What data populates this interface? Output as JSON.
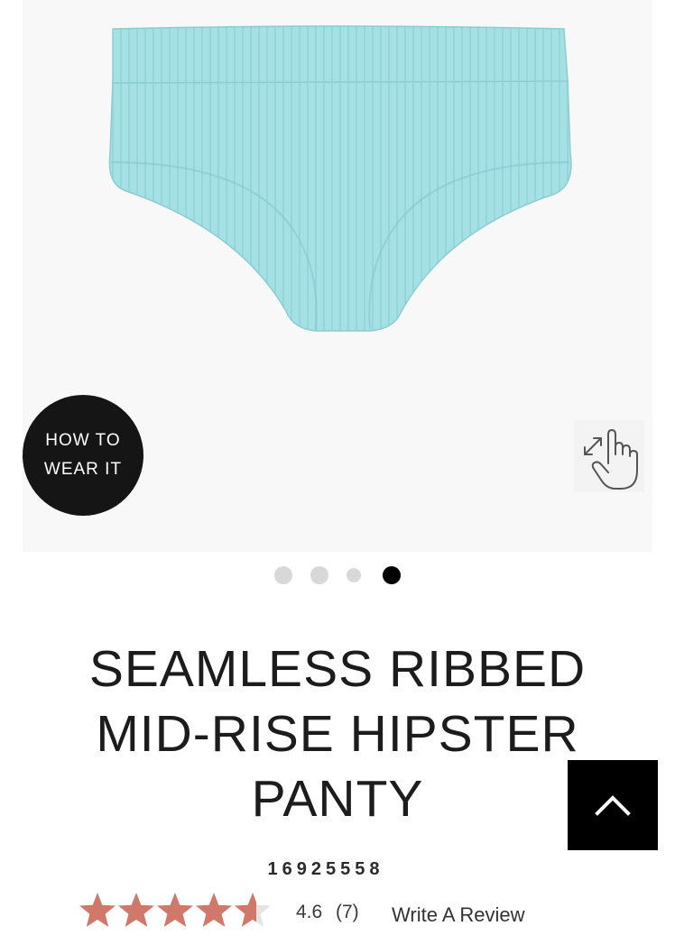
{
  "gallery": {
    "how_to_wear_line1": "HOW TO",
    "how_to_wear_line2": "WEAR IT",
    "zoom_icon": "pinch-zoom-hand-icon",
    "product_color": "#a4e0e4",
    "total_slides": 4,
    "active_slide": 4
  },
  "product": {
    "title_line1": "SEAMLESS RIBBED",
    "title_line2": "MID-RISE HIPSTER",
    "title_line3": "PANTY",
    "sku": "16925558"
  },
  "rating": {
    "value": "4.6",
    "stars_value": 4.6,
    "stars_max": 5,
    "count_label": "(7)",
    "write_review_label": "Write A Review",
    "star_color": "#d0786a",
    "star_empty_color": "#e4e4e4"
  },
  "back_to_top": {
    "icon": "chevron-up-icon"
  }
}
